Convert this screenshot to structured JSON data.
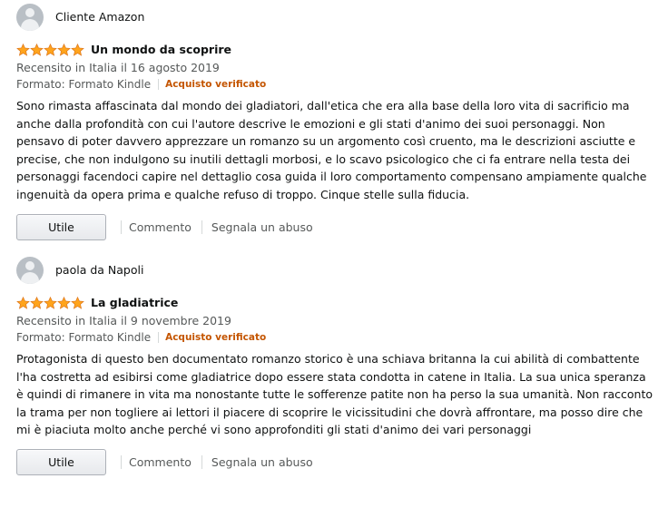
{
  "reviews": [
    {
      "author": "Cliente Amazon",
      "rating": 5,
      "title": "Un mondo da scoprire",
      "date": "Recensito in Italia il 16 agosto 2019",
      "format": "Formato: Formato Kindle",
      "verified": "Acquisto verificato",
      "body": "Sono rimasta affascinata dal mondo dei gladiatori, dall'etica che era alla base della loro vita di sacrificio ma anche dalla profondità con cui l'autore descrive le emozioni e gli stati d'animo dei suoi personaggi. Non pensavo di poter davvero apprezzare un romanzo su un argomento così cruento, ma le descrizioni asciutte e precise, che non indulgono su inutili dettagli morbosi, e lo scavo psicologico che ci fa entrare nella testa dei personaggi facendoci capire nel dettaglio cosa guida il loro comportamento compensano ampiamente qualche ingenuità da opera prima e qualche refuso di troppo. Cinque stelle sulla fiducia.",
      "helpful_label": "Utile",
      "comment_label": "Commento",
      "report_label": "Segnala un abuso"
    },
    {
      "author": "paola da Napoli",
      "rating": 5,
      "title": "La gladiatrice",
      "date": "Recensito in Italia il 9 novembre 2019",
      "format": "Formato: Formato Kindle",
      "verified": "Acquisto verificato",
      "body": "Protagonista di questo ben documentato romanzo storico è una schiava britanna la cui abilità di combattente l'ha costretta ad esibirsi come gladiatrice dopo essere stata condotta in catene in Italia. La sua unica speranza è quindi di rimanere in vita ma nonostante tutte le sofferenze patite non ha perso la sua umanità. Non racconto la trama per non togliere ai lettori il piacere di scoprire le vicissitudini che dovrà affrontare, ma posso dire che mi è piaciuta molto anche perché vi sono approfonditi gli stati d'animo dei vari personaggi",
      "helpful_label": "Utile",
      "comment_label": "Commento",
      "report_label": "Segnala un abuso"
    }
  ],
  "colors": {
    "star": "#ffa41c",
    "star_stroke": "#de7921",
    "verified": "#c45500",
    "secondary_text": "#565959"
  },
  "icons": {
    "avatar": "user-avatar-icon",
    "star": "star-icon"
  }
}
